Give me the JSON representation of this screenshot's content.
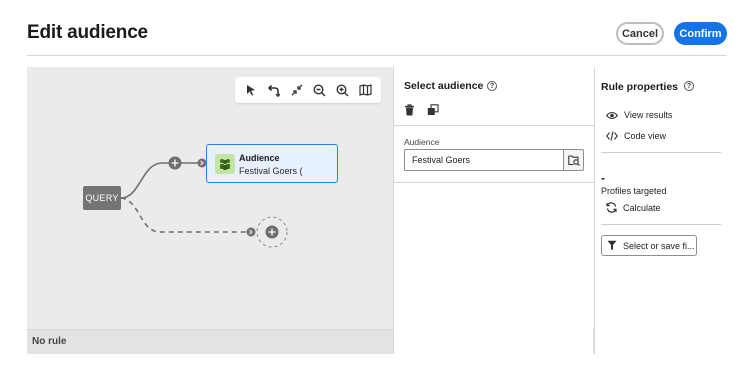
{
  "header": {
    "title": "Edit audience",
    "cancel_label": "Cancel",
    "confirm_label": "Confirm"
  },
  "colors": {
    "accent": "#1473e6",
    "node_selected_border": "#2680eb",
    "audience_icon_bg": "#c4e4a4"
  },
  "toolbar": {
    "icons": [
      "pointer-icon",
      "undo-icon",
      "collapse-icon",
      "zoom-out-icon",
      "zoom-in-icon",
      "map-icon"
    ]
  },
  "canvas": {
    "query_label": "QUERY",
    "audience_node": {
      "title": "Audience",
      "subtitle": "Festival Goers ("
    },
    "footer_text": "No rule"
  },
  "select_audience": {
    "title": "Select audience",
    "field_label": "Audience",
    "field_value": "Festival Goers"
  },
  "rule_properties": {
    "title": "Rule properties",
    "view_results": "View results",
    "code_view": "Code view",
    "count": "-",
    "profiles_targeted": "Profiles targeted",
    "calculate": "Calculate",
    "filter_button": "Select or save fi..."
  }
}
